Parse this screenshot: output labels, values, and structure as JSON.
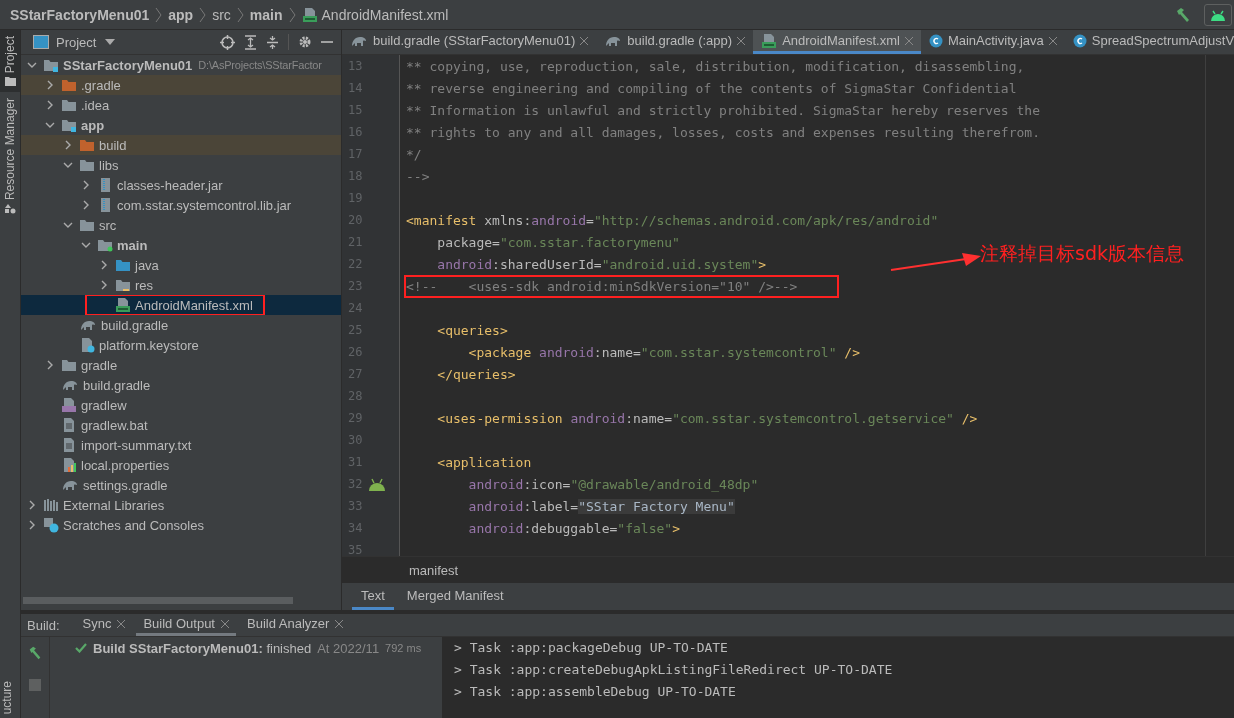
{
  "breadcrumbs": [
    {
      "label": "SStarFactoryMenu01",
      "bold": true,
      "kind": "folder"
    },
    {
      "label": "app",
      "bold": true,
      "kind": "folder"
    },
    {
      "label": "src",
      "bold": false,
      "kind": "folder"
    },
    {
      "label": "main",
      "bold": true,
      "kind": "folder"
    },
    {
      "label": "AndroidManifest.xml",
      "bold": false,
      "kind": "manifest"
    }
  ],
  "left_strip": [
    {
      "label": "Project",
      "selected": true,
      "kind": "folder"
    },
    {
      "label": "Resource Manager",
      "selected": false,
      "kind": "shapes"
    }
  ],
  "left_strip_bottom": "ucture",
  "project": {
    "title": "Project",
    "tree": [
      {
        "label": "SStarFactoryMenu01",
        "path": "D:\\AsProjects\\SStarFactor",
        "kind": "module",
        "bold": true,
        "expanded": true,
        "selected": false,
        "children": [
          {
            "label": ".gradle",
            "kind": "folder",
            "excluded": true,
            "expanded": false,
            "selected": false
          },
          {
            "label": ".idea",
            "kind": "folder",
            "expanded": false,
            "selected": false
          },
          {
            "label": "app",
            "kind": "module",
            "bold": true,
            "expanded": true,
            "selected": false,
            "children": [
              {
                "label": "build",
                "kind": "folder",
                "excluded": true,
                "expanded": false,
                "selected": false
              },
              {
                "label": "libs",
                "kind": "folder",
                "expanded": true,
                "selected": false,
                "children": [
                  {
                    "label": "classes-header.jar",
                    "kind": "jar",
                    "expanded": false,
                    "selected": false
                  },
                  {
                    "label": "com.sstar.systemcontrol.lib.jar",
                    "kind": "jar",
                    "expanded": false,
                    "selected": false
                  }
                ]
              },
              {
                "label": "src",
                "kind": "folder",
                "expanded": true,
                "selected": false,
                "children": [
                  {
                    "label": "main",
                    "kind": "source",
                    "bold": true,
                    "expanded": true,
                    "selected": false,
                    "children": [
                      {
                        "label": "java",
                        "kind": "java",
                        "expanded": false,
                        "selected": false
                      },
                      {
                        "label": "res",
                        "kind": "res",
                        "expanded": false,
                        "selected": false
                      },
                      {
                        "label": "AndroidManifest.xml",
                        "kind": "manifest",
                        "selected": true,
                        "highlighted": true
                      }
                    ]
                  }
                ]
              },
              {
                "label": "build.gradle",
                "kind": "gradle",
                "selected": false
              },
              {
                "label": "platform.keystore",
                "kind": "keystore",
                "selected": false
              }
            ]
          },
          {
            "label": "gradle",
            "kind": "folder",
            "expanded": false,
            "selected": false
          },
          {
            "label": "build.gradle",
            "kind": "gradle",
            "selected": false
          },
          {
            "label": "gradlew",
            "kind": "script",
            "selected": false
          },
          {
            "label": "gradlew.bat",
            "kind": "text",
            "selected": false
          },
          {
            "label": "import-summary.txt",
            "kind": "text",
            "selected": false
          },
          {
            "label": "local.properties",
            "kind": "properties",
            "selected": false
          },
          {
            "label": "settings.gradle",
            "kind": "gradle",
            "selected": false
          }
        ]
      },
      {
        "label": "External Libraries",
        "kind": "libraries",
        "expanded": false,
        "selected": false
      },
      {
        "label": "Scratches and Consoles",
        "kind": "scratches",
        "expanded": false,
        "selected": false
      }
    ]
  },
  "editor_tabs": [
    {
      "label": "build.gradle (SStarFactoryMenu01)",
      "kind": "gradle",
      "selected": false,
      "closable": true
    },
    {
      "label": "build.gradle (:app)",
      "kind": "gradle",
      "selected": false,
      "closable": true
    },
    {
      "label": "AndroidManifest.xml",
      "kind": "manifest",
      "selected": true,
      "closable": true
    },
    {
      "label": "MainActivity.java",
      "kind": "class",
      "selected": false,
      "closable": true
    },
    {
      "label": "SpreadSpectrumAdjustV",
      "kind": "class",
      "selected": false,
      "closable": false
    }
  ],
  "code": [
    {
      "number": "13",
      "tokens": [
        {
          "kind": "comment",
          "text": "** copying, use, reproduction, sale, distribution, modification, disassembling,"
        }
      ]
    },
    {
      "number": "14",
      "tokens": [
        {
          "kind": "comment",
          "text": "** reverse engineering and compiling of the contents of SigmaStar Confidential"
        }
      ]
    },
    {
      "number": "15",
      "tokens": [
        {
          "kind": "comment",
          "text": "** Information is unlawful and strictly prohibited. SigmaStar hereby reserves the"
        }
      ]
    },
    {
      "number": "16",
      "tokens": [
        {
          "kind": "comment",
          "text": "** rights to any and all damages, losses, costs and expenses resulting therefrom."
        }
      ]
    },
    {
      "number": "17",
      "tokens": [
        {
          "kind": "comment",
          "text": "*/"
        }
      ]
    },
    {
      "number": "18",
      "tokens": [
        {
          "kind": "comment",
          "text": "-->"
        }
      ]
    },
    {
      "number": "19"
    },
    {
      "number": "20",
      "tokens": [
        {
          "kind": "tag",
          "text": "<manifest"
        },
        {
          "kind": "attr",
          "text": " xmlns:"
        },
        {
          "kind": "ns",
          "text": "android"
        },
        {
          "kind": "attr",
          "text": "="
        },
        {
          "kind": "value",
          "text": "\"http://schemas.android.com/apk/res/android\""
        }
      ]
    },
    {
      "number": "21",
      "tokens": [
        {
          "kind": "attr",
          "text": "    package="
        },
        {
          "kind": "value",
          "text": "\"com.sstar.factorymenu\""
        }
      ]
    },
    {
      "number": "22",
      "tokens": [
        {
          "kind": "ns",
          "text": "    android"
        },
        {
          "kind": "attr",
          "text": ":sharedUserId="
        },
        {
          "kind": "value",
          "text": "\"android.uid.system\""
        },
        {
          "kind": "tag",
          "text": ">"
        }
      ]
    },
    {
      "number": "23",
      "highlighted": true,
      "tokens": [
        {
          "kind": "comment",
          "text": "<!--    <uses-sdk android:minSdkVersion=\"10\" />-->"
        }
      ]
    },
    {
      "number": "24"
    },
    {
      "number": "25",
      "tokens": [
        {
          "kind": "tag",
          "text": "    <queries>"
        }
      ]
    },
    {
      "number": "26",
      "tokens": [
        {
          "kind": "tag",
          "text": "        <package "
        },
        {
          "kind": "ns",
          "text": "android"
        },
        {
          "kind": "attr",
          "text": ":name="
        },
        {
          "kind": "value",
          "text": "\"com.sstar.systemcontrol\""
        },
        {
          "kind": "tag",
          "text": " />"
        }
      ]
    },
    {
      "number": "27",
      "tokens": [
        {
          "kind": "tag",
          "text": "    </queries>"
        }
      ]
    },
    {
      "number": "28"
    },
    {
      "number": "29",
      "tokens": [
        {
          "kind": "tag",
          "text": "    <uses-permission "
        },
        {
          "kind": "ns",
          "text": "android"
        },
        {
          "kind": "attr",
          "text": ":name="
        },
        {
          "kind": "value",
          "text": "\"com.sstar.systemcontrol.getservice\""
        },
        {
          "kind": "tag",
          "text": " />"
        }
      ]
    },
    {
      "number": "30"
    },
    {
      "number": "31",
      "tokens": [
        {
          "kind": "tag",
          "text": "    <application"
        }
      ]
    },
    {
      "number": "32",
      "gutter_icon": true,
      "tokens": [
        {
          "kind": "ns",
          "text": "        android"
        },
        {
          "kind": "attr",
          "text": ":icon="
        },
        {
          "kind": "value",
          "text": "\"@drawable/android_48dp\""
        }
      ]
    },
    {
      "number": "33",
      "tokens": [
        {
          "kind": "ns",
          "text": "        android"
        },
        {
          "kind": "attr",
          "text": ":label="
        },
        {
          "kind": "marked",
          "text": "\"SStar Factory Menu\""
        }
      ]
    },
    {
      "number": "34",
      "tokens": [
        {
          "kind": "ns",
          "text": "        android"
        },
        {
          "kind": "attr",
          "text": ":debuggable="
        },
        {
          "kind": "value",
          "text": "\"false\""
        },
        {
          "kind": "tag",
          "text": ">"
        }
      ]
    },
    {
      "number": "35"
    }
  ],
  "annotation": {
    "text": "注释掉目标sdk版本信息"
  },
  "editor_breadcrumb": "manifest",
  "editor_bottom_tabs": [
    {
      "label": "Text",
      "selected": true
    },
    {
      "label": "Merged Manifest",
      "selected": false
    }
  ],
  "build_panel": {
    "label": "Build:",
    "tabs": [
      {
        "label": "Sync",
        "selected": false
      },
      {
        "label": "Build Output",
        "selected": true
      },
      {
        "label": "Build Analyzer",
        "selected": false
      }
    ],
    "result": {
      "kind": "success",
      "text": "**Build SStarFactoryMenu01:** finished",
      "time": "At 2022/11",
      "duration": "792 ms"
    },
    "console": [
      "> Task :app:packageDebug UP-TO-DATE",
      "> Task :app:createDebugApkListingFileRedirect UP-TO-DATE",
      "> Task :app:assembleDebug UP-TO-DATE"
    ]
  }
}
